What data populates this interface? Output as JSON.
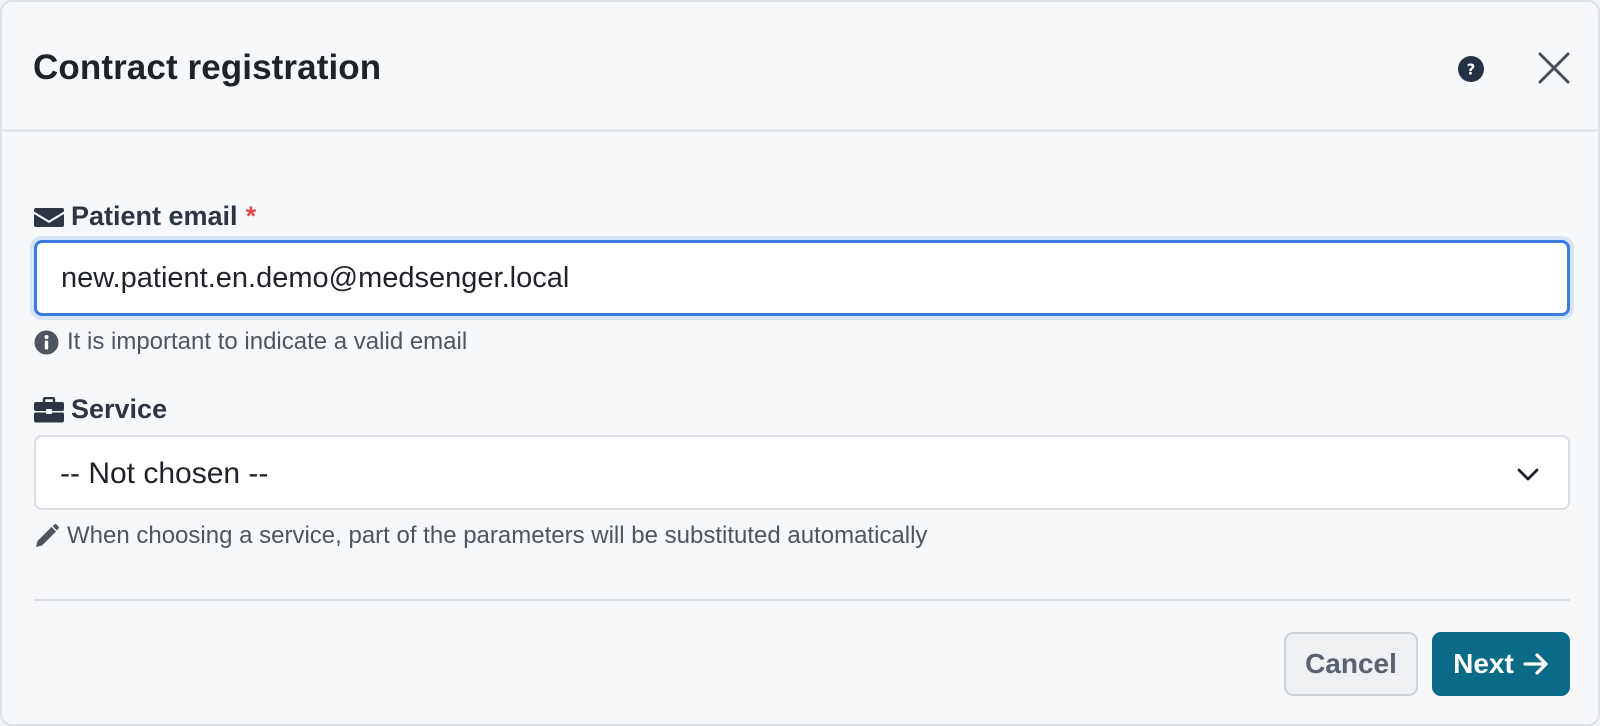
{
  "modal": {
    "title": "Contract registration",
    "help_icon": "question-circle-icon",
    "close_icon": "close-icon"
  },
  "email_field": {
    "icon": "envelope-icon",
    "label": "Patient email",
    "required_marker": "*",
    "value": "new.patient.en.demo@medsenger.local",
    "hint_icon": "info-circle-icon",
    "hint": "It is important to indicate a valid email",
    "focus_color": "#3b7be0"
  },
  "service_field": {
    "icon": "briefcase-icon",
    "label": "Service",
    "selected": "-- Not chosen --",
    "hint_icon": "pencil-icon",
    "hint": "When choosing a service, part of the parameters will be substituted automatically"
  },
  "footer": {
    "cancel_label": "Cancel",
    "next_label": "Next",
    "next_icon": "arrow-right-icon",
    "primary_color": "#0b6b86",
    "required_color": "#e5484d"
  }
}
